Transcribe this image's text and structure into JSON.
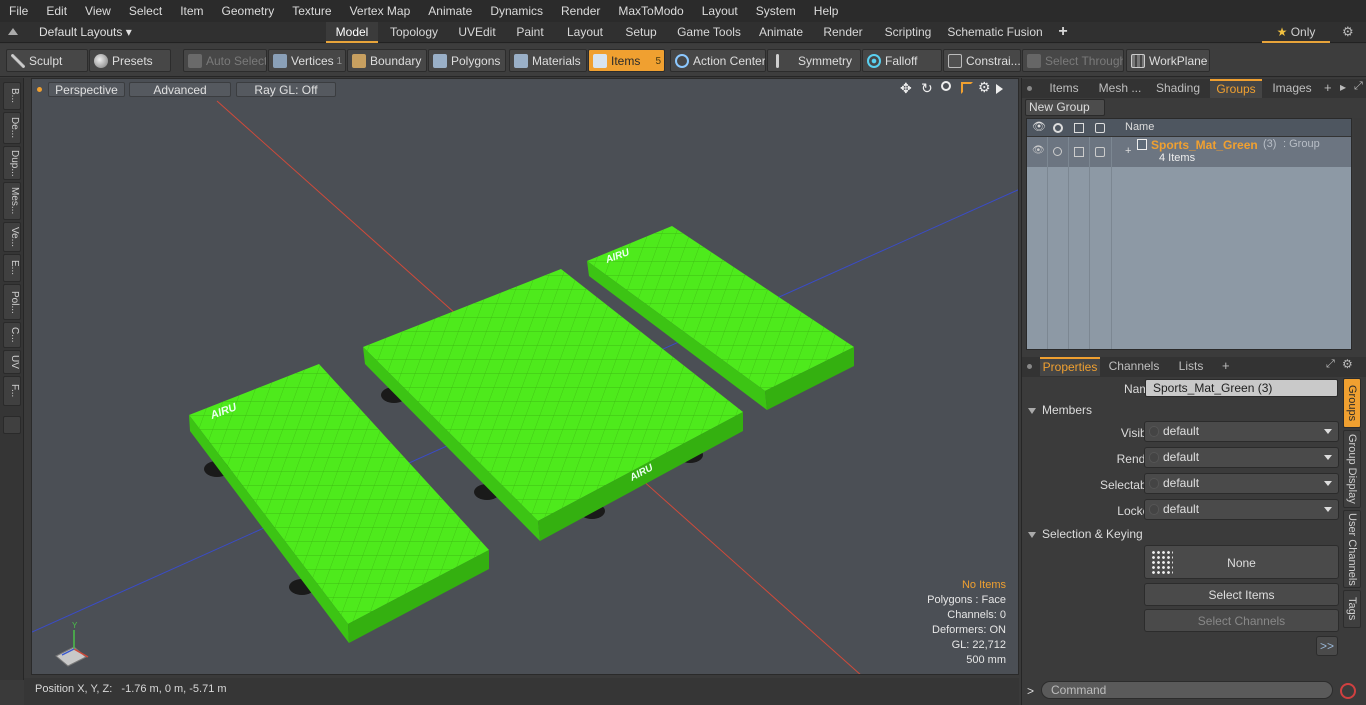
{
  "menu": [
    "File",
    "Edit",
    "View",
    "Select",
    "Item",
    "Geometry",
    "Texture",
    "Vertex Map",
    "Animate",
    "Dynamics",
    "Render",
    "MaxToModo",
    "Layout",
    "System",
    "Help"
  ],
  "layouts": {
    "dropdown": "Default Layouts",
    "tabs": [
      "Model",
      "Topology",
      "UVEdit",
      "Paint",
      "Layout",
      "Setup",
      "Game Tools",
      "Animate",
      "Render",
      "Scripting",
      "Schematic Fusion"
    ],
    "active": "Model",
    "add": "+",
    "only": "Only"
  },
  "toolbar": {
    "sculpt": "Sculpt",
    "presets": "Presets",
    "auto_select": "Auto Select",
    "vertices": "Vertices",
    "vertices_count": "1",
    "boundary": "Boundary",
    "polygons": "Polygons",
    "materials": "Materials",
    "items": "Items",
    "items_count": "5",
    "action_center": "Action Center",
    "symmetry": "Symmetry",
    "falloff": "Falloff",
    "constraints": "Constrai...",
    "select_through": "Select Through",
    "workplane": "WorkPlane"
  },
  "left_tabs": [
    "B...",
    "De...",
    "Dup...",
    "Mes...",
    "Ve...",
    "E...",
    "Pol...",
    "C...",
    "UV",
    "F..."
  ],
  "viewport": {
    "view": "Perspective",
    "shading": "Advanced",
    "raygl": "Ray GL: Off",
    "info": {
      "selection": "No Items",
      "polygons": "Polygons : Face",
      "channels": "Channels: 0",
      "deformers": "Deformers: ON",
      "gl": "GL: 22,712",
      "scale": "500 mm"
    },
    "mat_logo": "AIRU"
  },
  "status": {
    "position": "Position X, Y, Z:   -1.76 m, 0 m, -5.71 m"
  },
  "groups_panel": {
    "tabs": [
      "Items",
      "Mesh ...",
      "Shading",
      "Groups",
      "Images"
    ],
    "active": "Groups",
    "new_group": "New Group",
    "col_name": "Name",
    "group": {
      "name": "Sports_Mat_Green",
      "count": "(3)",
      "type": ": Group",
      "items": "4 Items"
    }
  },
  "properties": {
    "tabs": [
      "Properties",
      "Channels",
      "Lists"
    ],
    "active": "Properties",
    "name_label": "Name",
    "name_value": "Sports_Mat_Green (3)",
    "members": "Members",
    "visible_label": "Visible",
    "visible": "default",
    "render_label": "Render",
    "render": "default",
    "selectable_label": "Selectable",
    "selectable": "default",
    "locked_label": "Locked",
    "locked": "default",
    "sel_keying": "Selection & Keying",
    "none": "None",
    "select_items": "Select Items",
    "select_channels": "Select Channels",
    "more": ">>",
    "side_tabs": [
      "Groups",
      "Group Display",
      "User Channels",
      "Tags"
    ]
  },
  "command": {
    "prompt": ">",
    "placeholder": "Command"
  },
  "colors": {
    "accent": "#f0a030",
    "mat_green": "#4eea1c",
    "viewport_bg": "#4b4f55"
  }
}
